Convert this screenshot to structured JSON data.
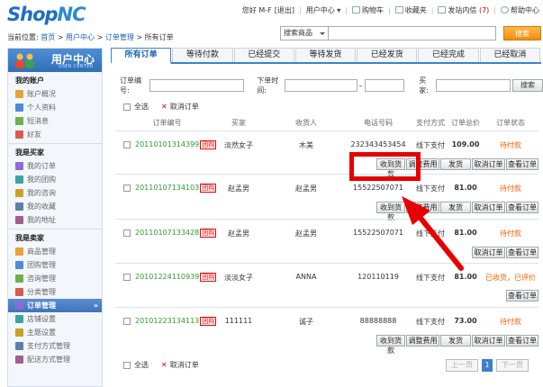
{
  "header": {
    "logo_main": "Shop",
    "logo_accent": "NC",
    "nav": {
      "greeting": "您好 M-F",
      "logout": "[退出]",
      "user_center": "用户中心",
      "cart": "购物车",
      "favorites": "收藏夹",
      "messages": "发站内信",
      "message_count": "(7)",
      "help": "帮助中心"
    }
  },
  "breadcrumb": {
    "label": "当前位置:",
    "home": "首页",
    "user_center": "用户中心",
    "order_manage": "订单管理",
    "current": "所有订单"
  },
  "search": {
    "scope": "搜索商品",
    "button": "搜索"
  },
  "sidebar": {
    "title": "用户中心",
    "subtitle": "USER CENTER",
    "sections": [
      {
        "title": "我的账户",
        "items": [
          "账户概况",
          "个人资料",
          "短消息",
          "好友"
        ]
      },
      {
        "title": "我是买家",
        "items": [
          "我的订单",
          "我的团购",
          "我的咨询",
          "我的收藏",
          "我的地址"
        ]
      },
      {
        "title": "我是卖家",
        "items": [
          "商品管理",
          "团购管理",
          "咨询管理",
          "分类管理",
          "订单管理",
          "店铺设置",
          "主题设置",
          "支付方式管理",
          "配送方式管理"
        ]
      }
    ],
    "active_item": "订单管理"
  },
  "tabs": [
    "所有订单",
    "等待付款",
    "已经提交",
    "等待发货",
    "已经发货",
    "已经完成",
    "已经取消"
  ],
  "filter": {
    "order_no_label": "订单编号:",
    "order_time_label": "下单时间:",
    "dash": "–",
    "buyer_label": "买家:",
    "search_button": "搜索"
  },
  "bulk": {
    "select_all": "全选",
    "cancel_order": "取消订单"
  },
  "table": {
    "headers": {
      "order_no": "订单编号",
      "seller": "买家",
      "buyer": "收货人",
      "phone": "电话号码",
      "pay": "支付方式",
      "total": "订单总价",
      "status": "订单状态"
    },
    "group_tag": "团购",
    "rows": [
      {
        "order_no": "20110101314399",
        "group": true,
        "seller": "淡然女子",
        "receiver": "木美",
        "phone": "232343453454",
        "pay": "线下支付",
        "total": "109.00",
        "status": "待付款",
        "actions": [
          "收到货款",
          "调整费用",
          "发货",
          "取消订单",
          "查看订单"
        ]
      },
      {
        "order_no": "20110107134103",
        "group": true,
        "seller": "赵孟男",
        "receiver": "赵孟男",
        "phone": "15522507071",
        "pay": "线下支付",
        "total": "81.00",
        "status": "待付款",
        "actions": [
          "收到货款",
          "调整费用",
          "发货",
          "取消订单",
          "查看订单"
        ]
      },
      {
        "order_no": "20110107133428",
        "group": true,
        "seller": "赵孟男",
        "receiver": "赵孟男",
        "phone": "15522507071",
        "pay": "线下支付",
        "total": "81.00",
        "status": "待付款",
        "actions": [
          "取消订单",
          "查看订单"
        ]
      },
      {
        "order_no": "20101224110939",
        "group": true,
        "seller": "淡淡女子",
        "receiver": "ANNA",
        "phone": "120110119",
        "pay": "线下支付",
        "total": "81.00",
        "status": "已收货，已评价",
        "actions": [
          "查看订单"
        ]
      },
      {
        "order_no": "20101223134113",
        "group": true,
        "seller": "111111",
        "receiver": "诚子",
        "phone": "88888888",
        "pay": "线下支付",
        "total": "73.00",
        "status": "待付款",
        "actions": [
          "收到货款",
          "调整费用",
          "发货",
          "取消订单",
          "查看订单"
        ]
      }
    ]
  },
  "pagination": {
    "prev": "上一页",
    "current": "1",
    "next": "下一页"
  },
  "colors": {
    "brand_blue": "#1a6fc4",
    "tab_blue": "#3b82c8",
    "highlight_red": "#e60000",
    "order_green": "#2e9a2e",
    "status_orange": "#f06000"
  }
}
